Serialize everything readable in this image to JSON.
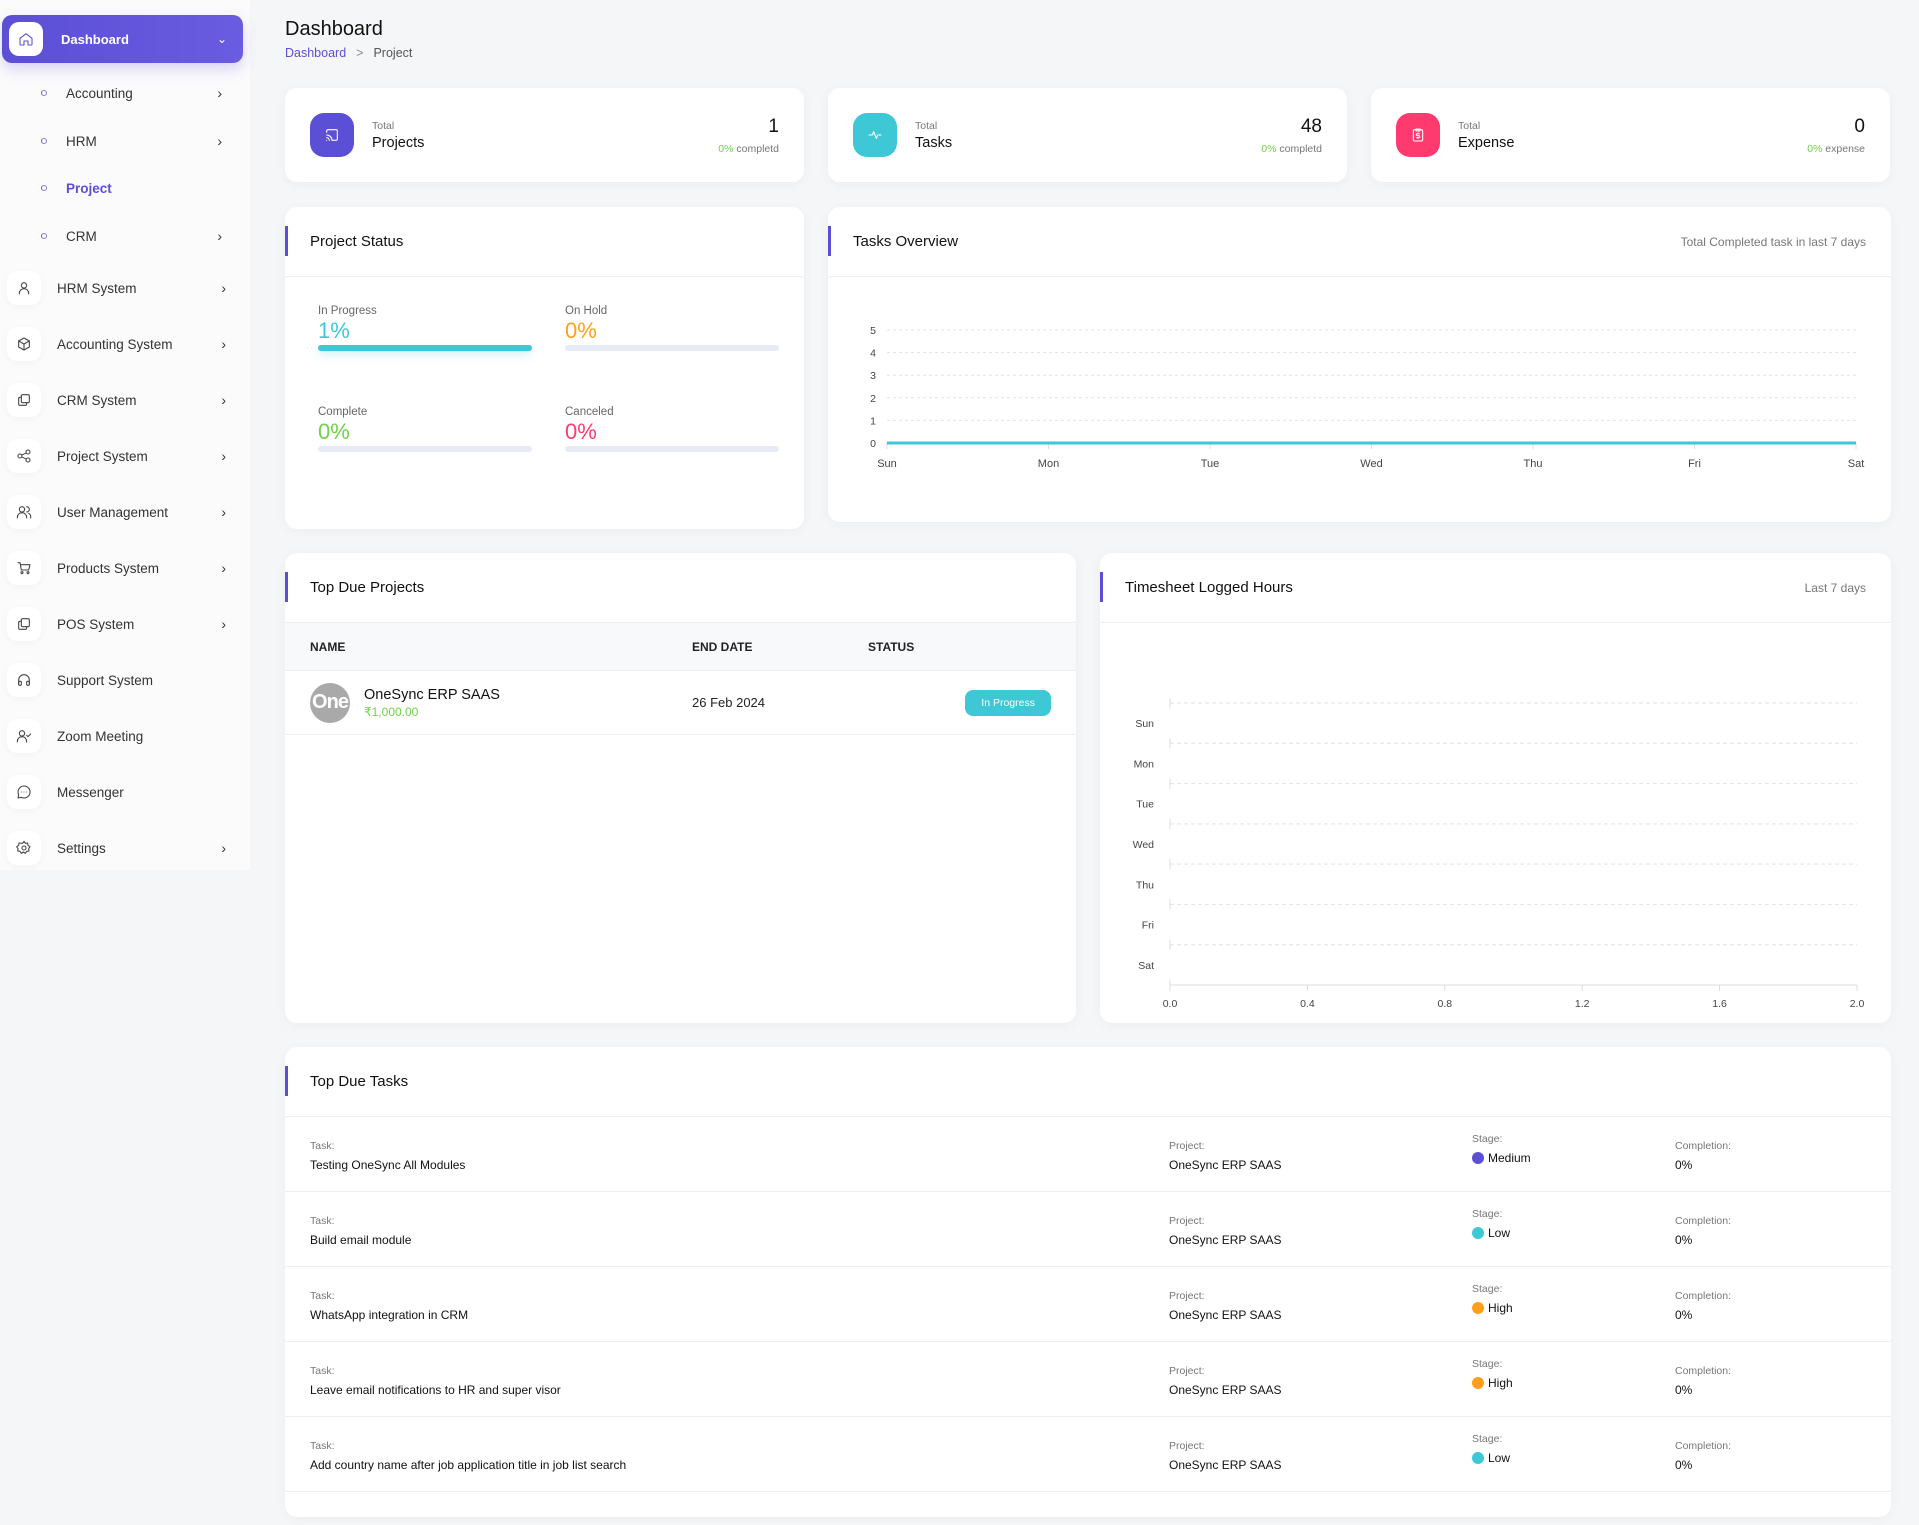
{
  "sidebar": {
    "active": {
      "label": "Dashboard",
      "icon": "home-icon"
    },
    "sub_items": [
      {
        "label": "Accounting",
        "has_chevron": true,
        "active": false
      },
      {
        "label": "HRM",
        "has_chevron": true,
        "active": false
      },
      {
        "label": "Project",
        "has_chevron": false,
        "active": true
      },
      {
        "label": "CRM",
        "has_chevron": true,
        "active": false
      }
    ],
    "items": [
      {
        "label": "HRM System",
        "icon": "user-icon",
        "has_chevron": true
      },
      {
        "label": "Accounting System",
        "icon": "box-icon",
        "has_chevron": true
      },
      {
        "label": "CRM System",
        "icon": "layers-icon",
        "has_chevron": true
      },
      {
        "label": "Project System",
        "icon": "share-icon",
        "has_chevron": true
      },
      {
        "label": "User Management",
        "icon": "users-icon",
        "has_chevron": true
      },
      {
        "label": "Products System",
        "icon": "cart-icon",
        "has_chevron": true
      },
      {
        "label": "POS System",
        "icon": "layers-icon",
        "has_chevron": true
      },
      {
        "label": "Support System",
        "icon": "headphones-icon",
        "has_chevron": false
      },
      {
        "label": "Zoom Meeting",
        "icon": "user-check-icon",
        "has_chevron": false
      },
      {
        "label": "Messenger",
        "icon": "message-icon",
        "has_chevron": false
      },
      {
        "label": "Settings",
        "icon": "gear-icon",
        "has_chevron": true
      }
    ]
  },
  "header": {
    "title": "Dashboard",
    "breadcrumb": {
      "link": "Dashboard",
      "separator": ">",
      "current": "Project"
    }
  },
  "stats": [
    {
      "small": "Total",
      "name": "Projects",
      "value": "1",
      "pct": "0%",
      "sub": "completd",
      "icon": "cast-icon",
      "color": "#5b4fd6"
    },
    {
      "small": "Total",
      "name": "Tasks",
      "value": "48",
      "pct": "0%",
      "sub": "completd",
      "icon": "activity-icon",
      "color": "#3ec8d6"
    },
    {
      "small": "Total",
      "name": "Expense",
      "value": "0",
      "pct": "0%",
      "sub": "expense",
      "icon": "clipboard-dollar-icon",
      "color": "#ff3a6e"
    }
  ],
  "project_status": {
    "title": "Project Status",
    "items": [
      {
        "label": "In Progress",
        "value": "1%",
        "progress_percent": 1,
        "color": "#3ec8d6"
      },
      {
        "label": "On Hold",
        "value": "0%",
        "progress_percent": 0,
        "color": "#ff9f1c"
      },
      {
        "label": "Complete",
        "value": "0%",
        "progress_percent": 0,
        "color": "#6fd24a"
      },
      {
        "label": "Canceled",
        "value": "0%",
        "progress_percent": 0,
        "color": "#ff3a6e"
      }
    ]
  },
  "tasks_overview": {
    "title": "Tasks Overview",
    "subtitle": "Total Completed task in last 7 days"
  },
  "top_due_projects": {
    "title": "Top Due Projects",
    "columns": [
      "NAME",
      "END DATE",
      "STATUS"
    ],
    "rows": [
      {
        "avatar_text": "One",
        "name": "OneSync ERP SAAS",
        "amount": "₹1,000.00",
        "end_date": "26 Feb 2024",
        "status": "In Progress"
      }
    ]
  },
  "timesheet": {
    "title": "Timesheet Logged Hours",
    "subtitle": "Last 7 days"
  },
  "top_due_tasks": {
    "title": "Top Due Tasks",
    "labels": {
      "task": "Task:",
      "project": "Project:",
      "stage": "Stage:",
      "completion": "Completion:"
    },
    "rows": [
      {
        "task": "Testing OneSync All Modules",
        "project": "OneSync ERP SAAS",
        "stage": "Medium",
        "stage_color": "#5b4fd6",
        "completion": "0%"
      },
      {
        "task": "Build email module",
        "project": "OneSync ERP SAAS",
        "stage": "Low",
        "stage_color": "#3ec8d6",
        "completion": "0%"
      },
      {
        "task": "WhatsApp integration in CRM",
        "project": "OneSync ERP SAAS",
        "stage": "High",
        "stage_color": "#ff9f1c",
        "completion": "0%"
      },
      {
        "task": "Leave email notifications to HR and super visor",
        "project": "OneSync ERP SAAS",
        "stage": "High",
        "stage_color": "#ff9f1c",
        "completion": "0%"
      },
      {
        "task": "Add country name after job application title in job list search",
        "project": "OneSync ERP SAAS",
        "stage": "Low",
        "stage_color": "#3ec8d6",
        "completion": "0%"
      }
    ]
  },
  "chart_data": [
    {
      "type": "line",
      "title": "Tasks Overview",
      "categories": [
        "Sun",
        "Mon",
        "Tue",
        "Wed",
        "Thu",
        "Fri",
        "Sat"
      ],
      "series": [
        {
          "name": "Completed tasks",
          "values": [
            0,
            0,
            0,
            0,
            0,
            0,
            0
          ],
          "color": "#3ec8d6"
        }
      ],
      "yticks": [
        "0",
        "1",
        "2",
        "3",
        "4",
        "5"
      ],
      "ylim": [
        0,
        5
      ],
      "xlabel": "",
      "ylabel": "",
      "grid": true
    },
    {
      "type": "bar",
      "orientation": "horizontal",
      "title": "Timesheet Logged Hours",
      "categories": [
        "Sun",
        "Mon",
        "Tue",
        "Wed",
        "Thu",
        "Fri",
        "Sat"
      ],
      "series": [
        {
          "name": "Hours",
          "values": [
            0,
            0,
            0,
            0,
            0,
            0,
            0
          ]
        }
      ],
      "xticks": [
        "0.0",
        "0.4",
        "0.8",
        "1.2",
        "1.6",
        "2.0"
      ],
      "xlim": [
        0,
        2
      ],
      "xlabel": "",
      "ylabel": "",
      "grid": true
    }
  ]
}
